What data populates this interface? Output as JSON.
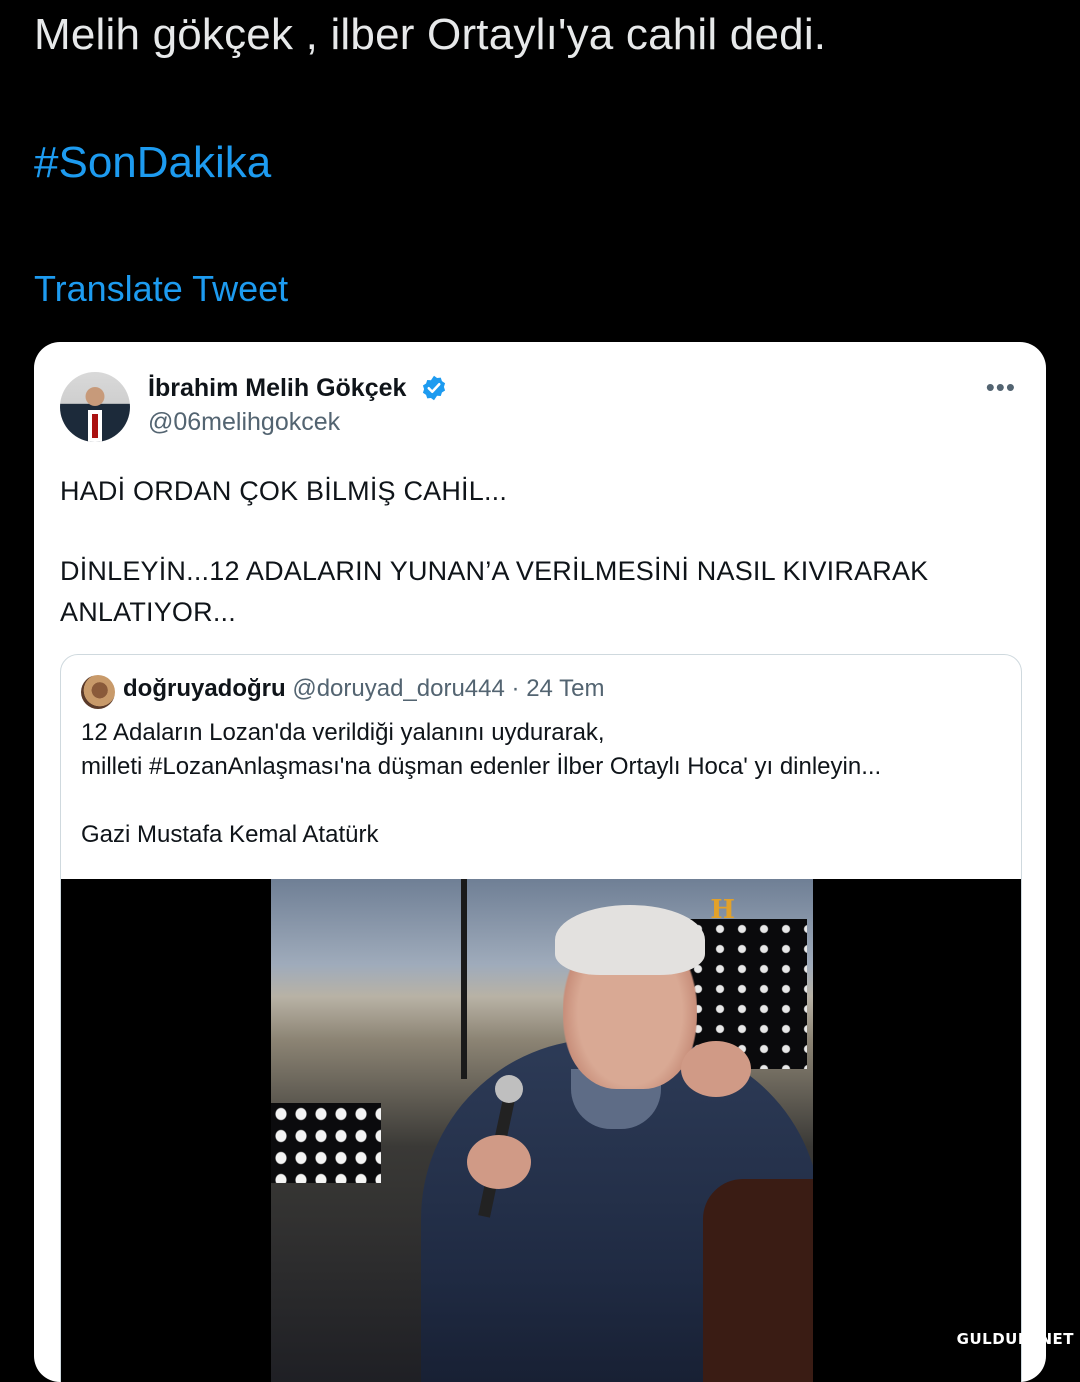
{
  "tweet": {
    "text": "Melih gökçek , ilber Ortaylı'ya cahil dedi.",
    "hashtag": "#SonDakika",
    "translate_label": "Translate Tweet"
  },
  "embedded_tweet": {
    "author_name": "İbrahim Melih Gökçek",
    "author_handle": "@06melihgokcek",
    "more_icon": "more-icon",
    "verified_color": "#1d9bf0",
    "body_lines": [
      "HADİ ORDAN ÇOK BİLMİŞ CAHİL...",
      "DİNLEYİN...12 ADALARIN YUNAN’A VERİLMESİNİ NASIL KIVIRARAK",
      "ANLATIYOR..."
    ]
  },
  "quoted_tweet": {
    "author_name": "doğruyadoğru",
    "author_handle": "@doruyad_doru444",
    "separator": " · ",
    "date": "24 Tem",
    "lines": [
      "12 Adaların Lozan'da verildiği yalanını uydurarak,",
      " milleti #LozanAnlaşması'na düşman edenler İlber Ortaylı Hoca' yı dinleyin...",
      "Gazi Mustafa Kemal Atatürk"
    ]
  },
  "video": {
    "channel_logo": "H"
  },
  "watermark": "GULDUM.NET",
  "colors": {
    "link": "#1d9bf0",
    "background": "#000000",
    "card": "#ffffff"
  }
}
